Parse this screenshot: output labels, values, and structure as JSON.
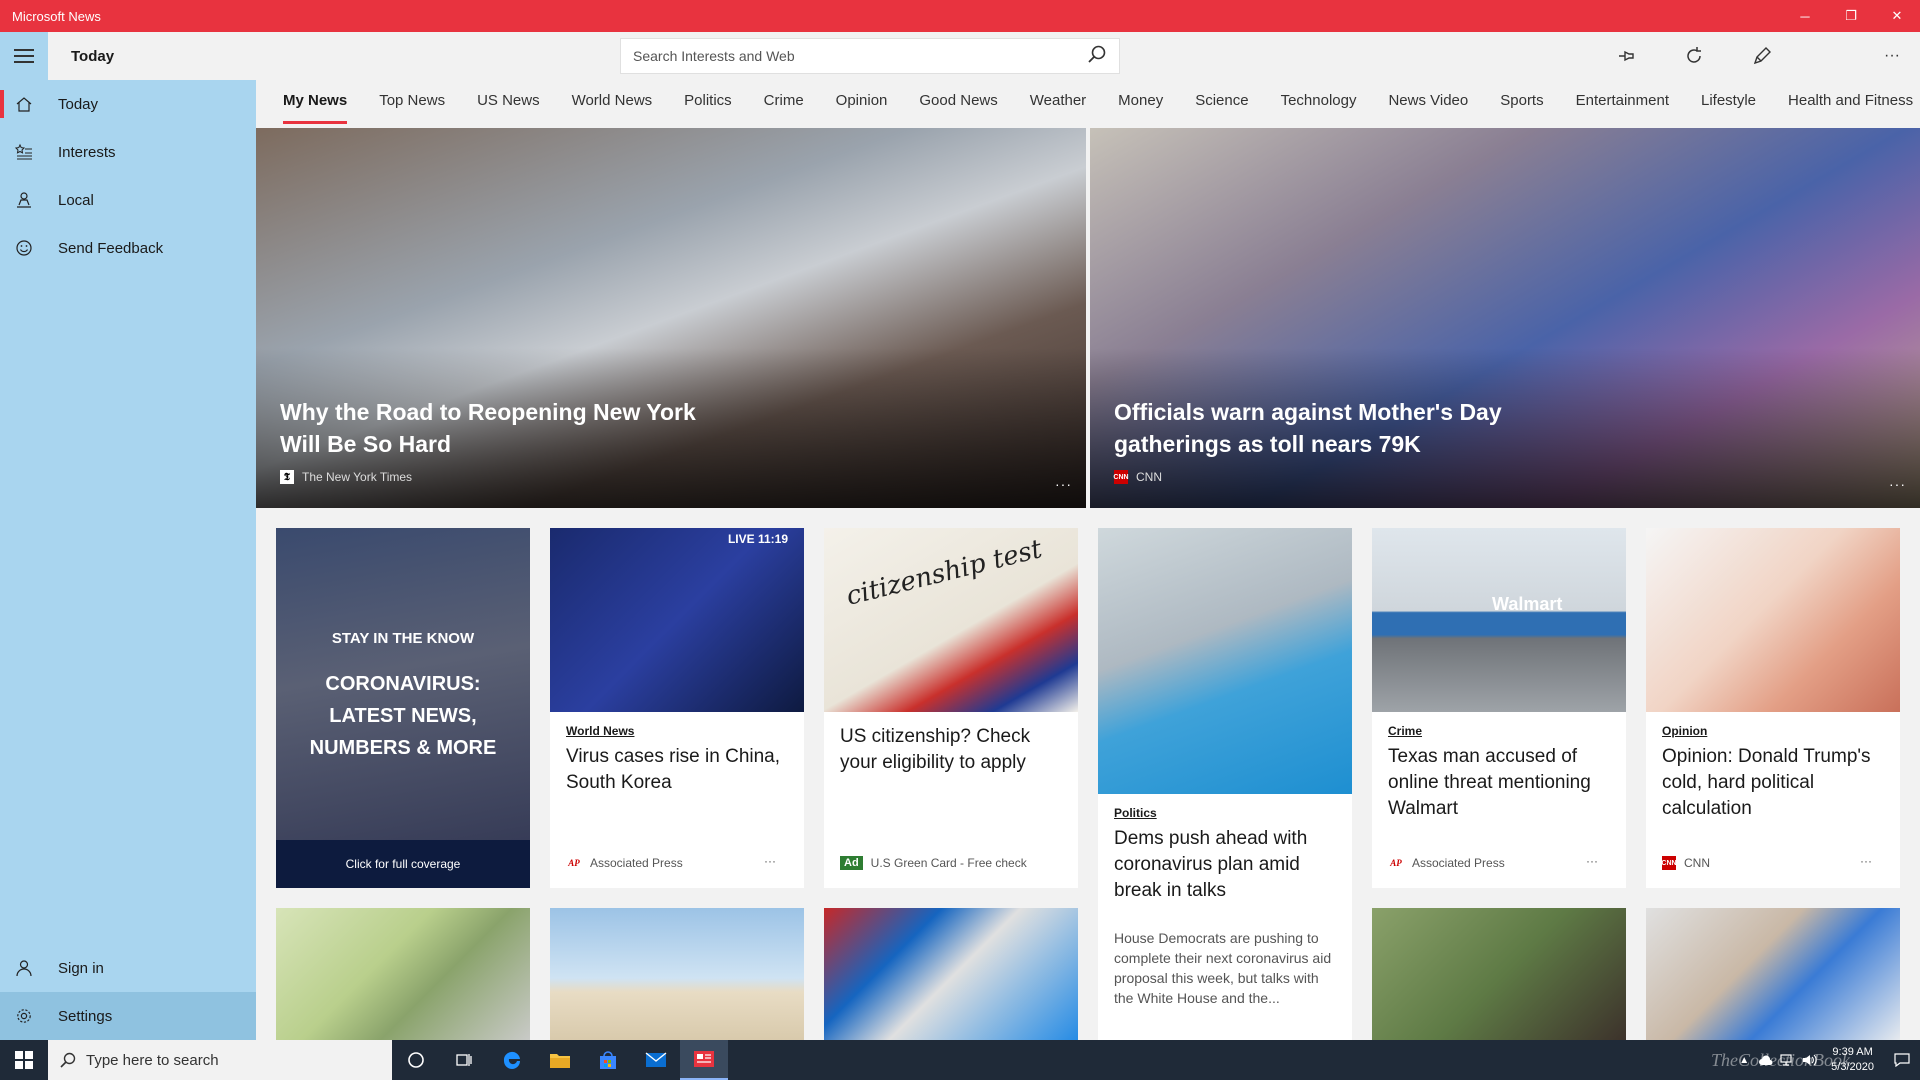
{
  "window": {
    "title": "Microsoft News",
    "minimize": "─",
    "restore": "❐",
    "close": "✕"
  },
  "header": {
    "page_title": "Today",
    "search_placeholder": "Search Interests and Web",
    "more": "···"
  },
  "sidebar": {
    "items": [
      {
        "label": "Today",
        "icon": "home-icon"
      },
      {
        "label": "Interests",
        "icon": "star-list-icon"
      },
      {
        "label": "Local",
        "icon": "person-pin-icon"
      },
      {
        "label": "Send Feedback",
        "icon": "smiley-icon"
      }
    ],
    "bottom": [
      {
        "label": "Sign in",
        "icon": "person-icon"
      },
      {
        "label": "Settings",
        "icon": "gear-icon"
      }
    ]
  },
  "tabs": [
    "My News",
    "Top News",
    "US News",
    "World News",
    "Politics",
    "Crime",
    "Opinion",
    "Good News",
    "Weather",
    "Money",
    "Science",
    "Technology",
    "News Video",
    "Sports",
    "Entertainment",
    "Lifestyle",
    "Health and Fitness"
  ],
  "heroes": [
    {
      "title": "Why the Road to Reopening New York Will Be So Hard",
      "source": "The New York Times",
      "logo": "𝕿",
      "more": "···"
    },
    {
      "title": "Officials warn against Mother's Day gatherings as toll nears 79K",
      "source": "CNN",
      "logo": "CNN",
      "more": "···"
    }
  ],
  "promo": {
    "kicker": "STAY IN THE KNOW",
    "headline": "CORONAVIRUS: LATEST NEWS, NUMBERS & MORE",
    "cta": "Click for full coverage"
  },
  "cards": [
    {
      "category": "World News",
      "title": "Virus cases rise in China, South Korea",
      "source": "Associated Press",
      "logo": "AP",
      "more": "···",
      "overlay_text": "LIVE 11:19"
    },
    {
      "title": "US citizenship? Check your eligibility to apply",
      "ad": "Ad",
      "source": "U.S Green Card - Free check",
      "overlay_text": "citizenship test"
    },
    {
      "category": "Politics",
      "title": "Dems push ahead with coronavirus plan amid break in talks",
      "summary": "House Democrats are pushing to complete their next coronavirus aid proposal this week, but talks with the White House and the..."
    },
    {
      "category": "Crime",
      "title": "Texas man accused of online threat mentioning Walmart",
      "source": "Associated Press",
      "logo": "AP",
      "more": "···",
      "overlay_text": "Walmart"
    },
    {
      "category": "Opinion",
      "title": "Opinion: Donald Trump's cold, hard political calculation",
      "source": "CNN",
      "logo": "CNN",
      "more": "···"
    }
  ],
  "taskbar": {
    "search_placeholder": "Type here to search",
    "time": "9:39 AM",
    "date": "5/3/2020",
    "watermark": "TheCollectionBook"
  },
  "colors": {
    "accent": "#e8333f",
    "sidebar": "#a9d5ef",
    "taskbar": "#1f2a38"
  }
}
